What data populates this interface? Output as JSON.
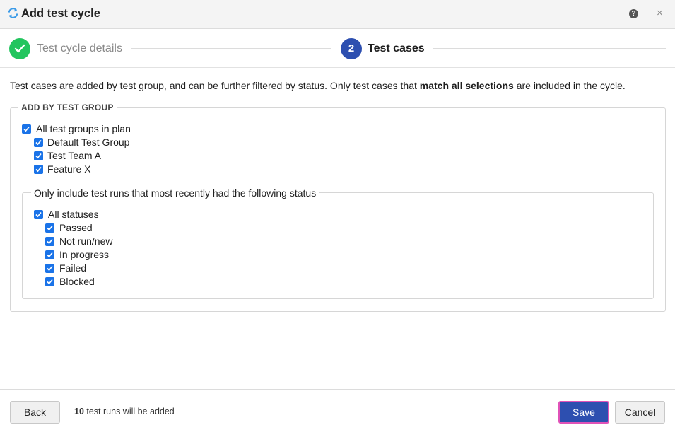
{
  "window": {
    "title": "Add test cycle",
    "icons": {
      "title": "sync-icon",
      "help": "help-icon",
      "close": "close-icon"
    },
    "help_glyph": "?",
    "close_glyph": "×"
  },
  "stepper": {
    "steps": [
      {
        "label": "Test cycle details",
        "state": "completed",
        "icon": "check-icon"
      },
      {
        "number": "2",
        "label": "Test cases",
        "state": "active"
      }
    ]
  },
  "intro": {
    "text_before": "Test cases are added by test group, and can be further filtered by status. Only test cases that ",
    "text_bold": "match all selections",
    "text_after": " are included in the cycle."
  },
  "test_groups": {
    "legend": "ADD BY TEST GROUP",
    "all": {
      "label": "All test groups in plan",
      "checked": true
    },
    "items": [
      {
        "label": "Default Test Group",
        "checked": true
      },
      {
        "label": "Test Team A",
        "checked": true
      },
      {
        "label": "Feature X",
        "checked": true
      }
    ]
  },
  "status_filter": {
    "legend": "Only include test runs that most recently had the following status",
    "all": {
      "label": "All statuses",
      "checked": true
    },
    "items": [
      {
        "label": "Passed",
        "checked": true
      },
      {
        "label": "Not run/new",
        "checked": true
      },
      {
        "label": "In progress",
        "checked": true
      },
      {
        "label": "Failed",
        "checked": true
      },
      {
        "label": "Blocked",
        "checked": true
      }
    ]
  },
  "footer": {
    "back_label": "Back",
    "count": "10",
    "count_suffix": " test runs will be added",
    "save_label": "Save",
    "cancel_label": "Cancel"
  },
  "colors": {
    "accent": "#2d4fb0",
    "checkbox": "#1a73e8",
    "completed_step": "#22c55e",
    "focus_ring": "#e052b8"
  }
}
